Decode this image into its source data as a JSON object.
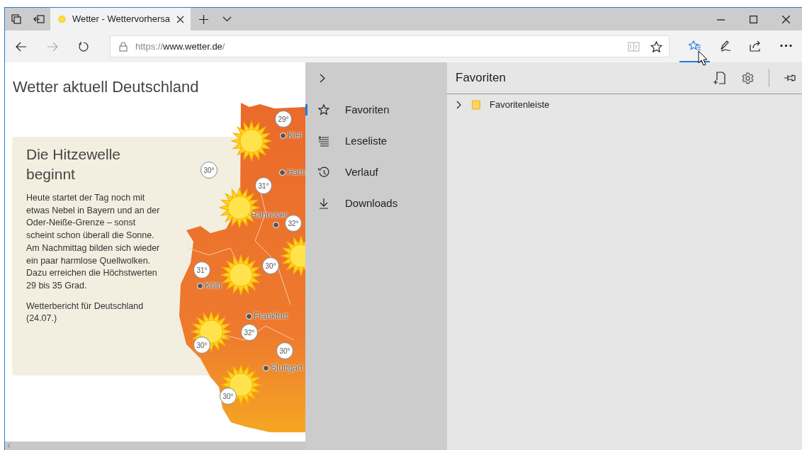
{
  "tabs": [
    {
      "title": "Wetter - Wettervorhersa",
      "selected": true
    }
  ],
  "address_bar": {
    "scheme": "https://",
    "host": "www.wetter.de",
    "path": "/"
  },
  "toolbar_buttons": [
    {
      "kind": "hub",
      "selected": true
    },
    {
      "kind": "notes",
      "selected": false
    },
    {
      "kind": "share",
      "selected": false
    },
    {
      "kind": "more",
      "selected": false
    }
  ],
  "page": {
    "title": "Wetter aktuell Deutschland",
    "article": {
      "heading": "Die Hitzewelle beginnt",
      "body": "Heute startet der Tag noch mit etwas Nebel in Bayern und an der Oder-Neiße-Grenze – sonst scheint schon überall die Sonne. Am Nachmittag bilden sich wieder ein paar harmlose Quellwolken. Dazu erreichen die Höchstwerten 29 bis 35 Grad.",
      "caption": "Wetterbericht für Deutschland (24.07.)"
    },
    "map": {
      "cities": [
        {
          "name": "Kiel"
        },
        {
          "name": "Ham"
        },
        {
          "name": "Hannover"
        },
        {
          "name": "Köln"
        },
        {
          "name": "Frankfurt"
        },
        {
          "name": "Stuttgart"
        }
      ],
      "temperatures": [
        "29°",
        "30°",
        "31°",
        "32°",
        "30°",
        "31°",
        "32°",
        "30°",
        "30°",
        "30°"
      ]
    }
  },
  "hub": {
    "nav": [
      {
        "kind": "favorites",
        "label": "Favoriten",
        "selected": true
      },
      {
        "kind": "reading",
        "label": "Leseliste",
        "selected": false
      },
      {
        "kind": "history",
        "label": "Verlauf",
        "selected": false
      },
      {
        "kind": "downloads",
        "label": "Downloads",
        "selected": false
      }
    ],
    "panel": {
      "title": "Favoriten",
      "folders": [
        {
          "name": "Favoritenleiste",
          "expanded": false
        }
      ]
    }
  }
}
